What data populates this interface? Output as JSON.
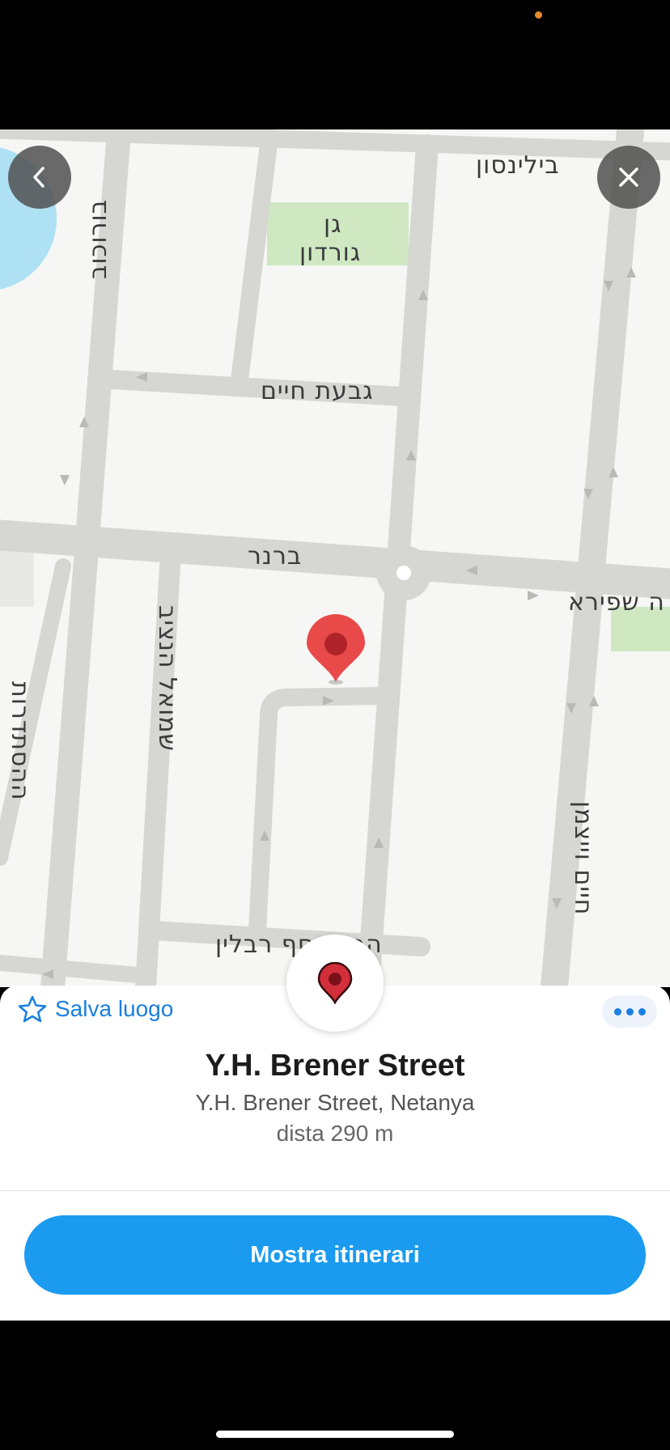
{
  "map": {
    "streets": {
      "bilinson": "בילינסון",
      "gan_gordon_1": "גן",
      "gan_gordon_2": "גורדון",
      "borochov": "בורוכוב",
      "givat_haim": "גבעת חיים",
      "brenner": "ברנר",
      "shapira": "ה שפירא",
      "histadrut": "ההסתדרות",
      "shmuel_hanatziv": "שמואל הנציב",
      "weizmann": "חיים וייצמן",
      "rabin": "הרב יוסף רבלין"
    }
  },
  "controls": {
    "back_icon": "chevron-left-icon",
    "close_icon": "close-icon"
  },
  "sheet": {
    "save_label": "Salva luogo",
    "title": "Y.H. Brener Street",
    "subtitle": "Y.H. Brener Street, Netanya",
    "distance": "dista 290 m",
    "route_button": "Mostra itinerari"
  },
  "colors": {
    "accent": "#1a7fe0",
    "route_button": "#1a9bf0",
    "pin": "#e84a4a",
    "park": "#cfe8c2"
  }
}
